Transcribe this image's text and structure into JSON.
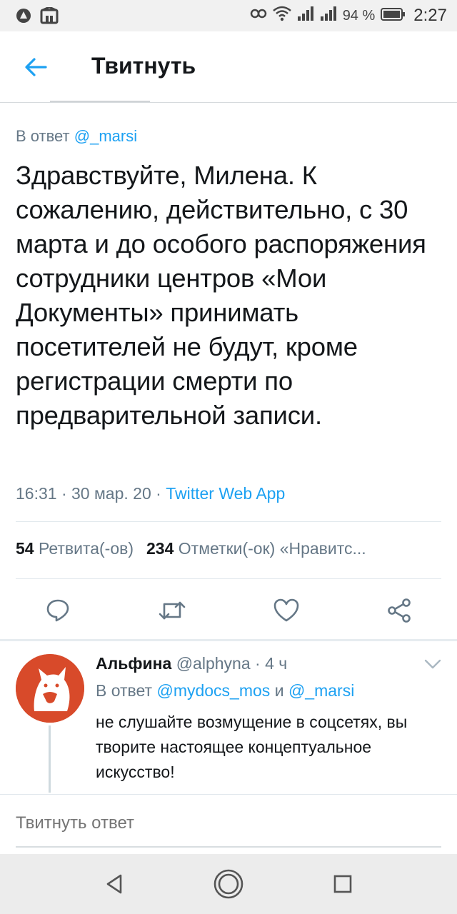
{
  "status_bar": {
    "battery_percent": "94 %",
    "time": "2:27",
    "icons": [
      "alert-icon",
      "notification-app-icon",
      "nfc-icon",
      "wifi-icon",
      "signal-icon",
      "signal-icon",
      "battery-icon"
    ]
  },
  "app_bar": {
    "back_icon": "arrow-left-icon",
    "title": "Твитнуть"
  },
  "tweet": {
    "reply_prefix": "В ответ",
    "reply_mention": "@_marsi",
    "text": "Здравствуйте, Милена. К сожалению, действительно, с 30 марта и до особого распоряжения сотрудники центров «Мои Документы» принимать посетителей не будут, кроме регистрации смерти по предварительной записи.",
    "time": "16:31",
    "sep1": "·",
    "date": "30 мар. 20",
    "sep2": "·",
    "source": "Twitter Web App",
    "retweet_count": "54",
    "retweet_label": "Ретвита(-ов)",
    "like_count": "234",
    "like_label": "Отметки(-ок) «Нравитс..."
  },
  "actions": {
    "reply_icon": "reply-icon",
    "retweet_icon": "retweet-icon",
    "like_icon": "heart-icon",
    "share_icon": "share-icon"
  },
  "reply": {
    "name": "Альфина",
    "handle": "@alphyna",
    "sep": "·",
    "age": "4 ч",
    "reply_prefix": "В ответ",
    "mention1": "@mydocs_mos",
    "conj": "и",
    "mention2": "@_marsi",
    "text": "не слушайте возмущение в соцсетях, вы творите настоящее концептуальное искусство!"
  },
  "compose": {
    "placeholder": "Твитнуть ответ"
  },
  "colors": {
    "accent": "#1da1f2",
    "text": "#14171a",
    "secondary": "#657786",
    "avatar_bg": "#d84a2a"
  },
  "nav_bar": {
    "icons": [
      "back-triangle-icon",
      "home-circle-icon",
      "recents-square-icon"
    ]
  }
}
